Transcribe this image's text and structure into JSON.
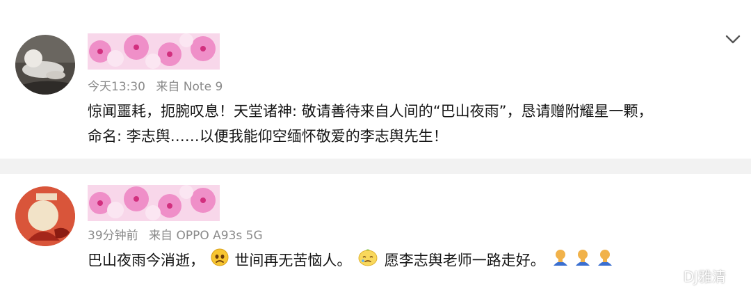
{
  "posts": [
    {
      "time": "今天13:30",
      "source": "来自 Note 9",
      "lines": [
        "惊闻噩耗，扼腕叹息！天堂诸神: 敬请善待来自人间的“巴山夜雨”，恳请赠附耀星一颗，",
        "命名: 李志舆……以便我能仰空缅怀敬爱的李志舆先生！"
      ]
    },
    {
      "time": "39分钟前",
      "source": "来自 OPPO A93s 5G",
      "segments": [
        "巴山夜雨今消逝，",
        "世间再无苦恼人。",
        "愿李志舆老师一路走好。"
      ],
      "emojis": [
        "sad-face-emoji",
        "tearful-lemon-emoji",
        "praying-figures-emoji"
      ]
    }
  ],
  "watermark": {
    "text": "DJ雅清",
    "icon": "wechat-bubble-icon"
  },
  "colors": {
    "meta": "#8a8a8a",
    "text": "#151515",
    "separator": "#f2f2f2",
    "flower_pink": "#f6a8d6"
  }
}
